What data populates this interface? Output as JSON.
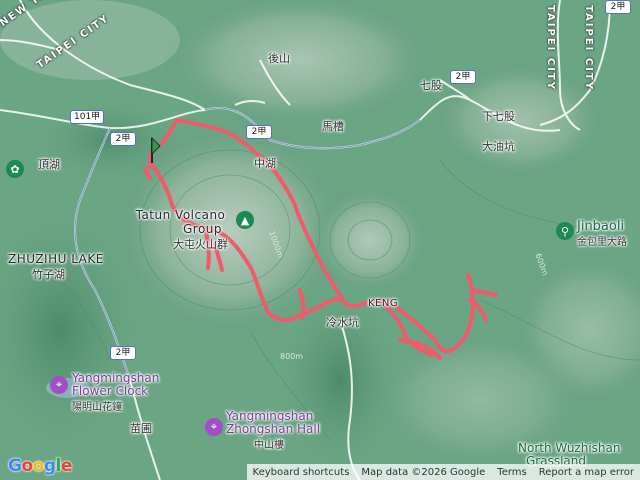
{
  "labels": {
    "new_taipei_city": "NEW TAIPEI CITY",
    "taipei_city_left": "TAIPEI CITY",
    "taipei_city_right_a": "TAIPEI CITY",
    "taipei_city_right_b": "TAIPEI CITY",
    "houshan": "後山",
    "qigu": "七股",
    "xiaqigu": "下七股",
    "maocao": "馬槽",
    "dayoukeng": "大油坑",
    "dinghu": "頂湖",
    "zhongzhou": "中湖",
    "tatun_en_1": "Tatun Volcano",
    "tatun_en_2": "Group",
    "tatun_zh": "大屯火山群",
    "zhuzihu_en": "ZHUZIHU LAKE",
    "zhuzihu_zh": "竹子湖",
    "lengshuikeng_zh": "冷水坑",
    "lengshuikeng_en": "KENG",
    "jinbaoli_en": "Jinbaoli",
    "jinbaoli_zh": "金包里大路",
    "flower_clock_en_1": "Yangmingshan",
    "flower_clock_en_2": "Flower Clock",
    "flower_clock_zh": "陽明山花鐘",
    "zhongshan_en_1": "Yangmingshan",
    "zhongshan_en_2": "Zhongshan Hall",
    "zhongshan_zh": "中山樓",
    "miaopu": "苗圃",
    "wuzhishan_1": "North Wuzhishan",
    "wuzhishan_2": "Grassland",
    "elev_1000": "1000m",
    "elev_800": "800m",
    "elev_600": "600m"
  },
  "road_badges": {
    "r101": "101甲",
    "r2_a": "2甲",
    "r2_b": "2甲",
    "r2_c": "2甲",
    "r2_d": "2甲",
    "r2_e": "2甲"
  },
  "footer": {
    "keyboard": "Keyboard shortcuts",
    "mapdata": "Map data ©2026 Google",
    "terms": "Terms",
    "report": "Report a map error"
  },
  "logo": "Google",
  "colors": {
    "track": "#ef5b6b",
    "start_marker": "#2e9a43",
    "terrain": "#5f9a7a"
  },
  "icons": {
    "poi_purple": "landmark-icon",
    "poi_green": "park-icon",
    "start": "start-flag-icon"
  }
}
